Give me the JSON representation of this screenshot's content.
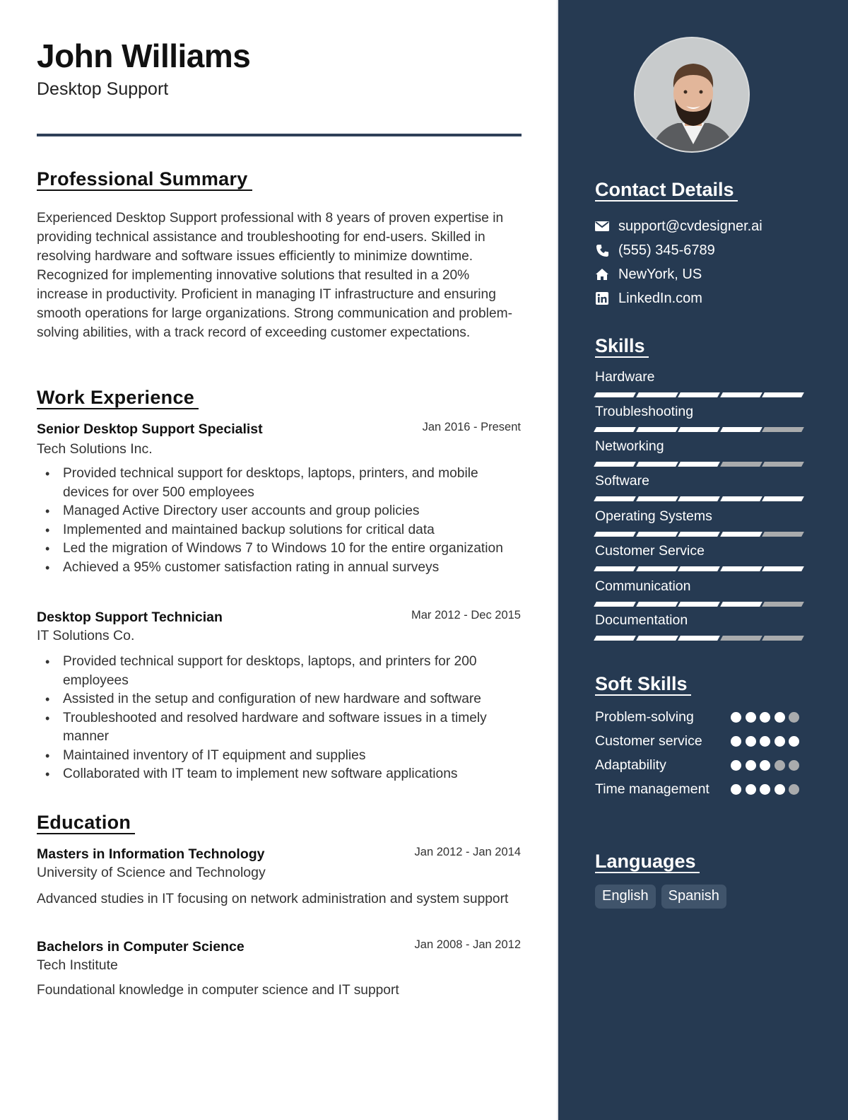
{
  "header": {
    "name": "John Williams",
    "role": "Desktop Support"
  },
  "summary": {
    "title": "Professional Summary",
    "text": "Experienced Desktop Support professional with 8 years of proven expertise in providing technical assistance and troubleshooting for end-users. Skilled in resolving hardware and software issues efficiently to minimize downtime. Recognized for implementing innovative solutions that resulted in a 20% increase in productivity. Proficient in managing IT infrastructure and ensuring smooth operations for large organizations. Strong communication and problem-solving abilities, with a track record of exceeding customer expectations."
  },
  "work": {
    "title": "Work Experience",
    "jobs": [
      {
        "title": "Senior Desktop Support Specialist",
        "date": "Jan 2016 - Present",
        "company": "Tech Solutions Inc.",
        "bullets": [
          "Provided technical support for desktops, laptops, printers, and mobile devices for over 500 employees",
          "Managed Active Directory user accounts and group policies",
          "Implemented and maintained backup solutions for critical data",
          "Led the migration of Windows 7 to Windows 10 for the entire organization",
          "Achieved a 95% customer satisfaction rating in annual surveys"
        ]
      },
      {
        "title": "Desktop Support Technician",
        "date": "Mar 2012 - Dec 2015",
        "company": "IT Solutions Co.",
        "bullets": [
          "Provided technical support for desktops, laptops, and printers for 200 employees",
          "Assisted in the setup and configuration of new hardware and software",
          "Troubleshooted and resolved hardware and software issues in a timely manner",
          "Maintained inventory of IT equipment and supplies",
          "Collaborated with IT team to implement new software applications"
        ]
      }
    ]
  },
  "education": {
    "title": "Education",
    "items": [
      {
        "degree": "Masters in Information Technology",
        "date": "Jan 2012 - Jan 2014",
        "school": "University of Science and Technology",
        "description": "Advanced studies in IT focusing on network administration and system support"
      },
      {
        "degree": "Bachelors in Computer Science",
        "date": "Jan 2008 - Jan 2012",
        "school": "Tech Institute",
        "description": "Foundational knowledge in computer science and IT support"
      }
    ]
  },
  "sidebar": {
    "photo_alt": "Profile photo",
    "contact": {
      "title": "Contact Details",
      "items": [
        {
          "icon": "envelope-icon",
          "text": "support@cvdesigner.ai"
        },
        {
          "icon": "phone-icon",
          "text": "(555) 345-6789"
        },
        {
          "icon": "home-icon",
          "text": "NewYork, US"
        },
        {
          "icon": "linkedin-icon",
          "text": "LinkedIn.com"
        }
      ]
    },
    "skills": {
      "title": "Skills",
      "max": 5,
      "items": [
        {
          "name": "Hardware",
          "level": 5
        },
        {
          "name": "Troubleshooting",
          "level": 4
        },
        {
          "name": "Networking",
          "level": 3
        },
        {
          "name": "Software",
          "level": 5
        },
        {
          "name": "Operating Systems",
          "level": 4
        },
        {
          "name": "Customer Service",
          "level": 5
        },
        {
          "name": "Communication",
          "level": 4
        },
        {
          "name": "Documentation",
          "level": 3
        }
      ]
    },
    "soft_skills": {
      "title": "Soft Skills",
      "max": 5,
      "items": [
        {
          "name": "Problem-solving",
          "level": 4
        },
        {
          "name": "Customer service",
          "level": 5
        },
        {
          "name": "Adaptability",
          "level": 3
        },
        {
          "name": "Time management",
          "level": 4
        }
      ]
    },
    "languages": {
      "title": "Languages",
      "items": [
        "English",
        "Spanish"
      ]
    }
  },
  "colors": {
    "sidebar_bg": "#263a52",
    "accent_rule": "#2f4058",
    "level_on": "#ffffff",
    "level_off": "#a9abad",
    "chip_bg": "#40546b"
  }
}
